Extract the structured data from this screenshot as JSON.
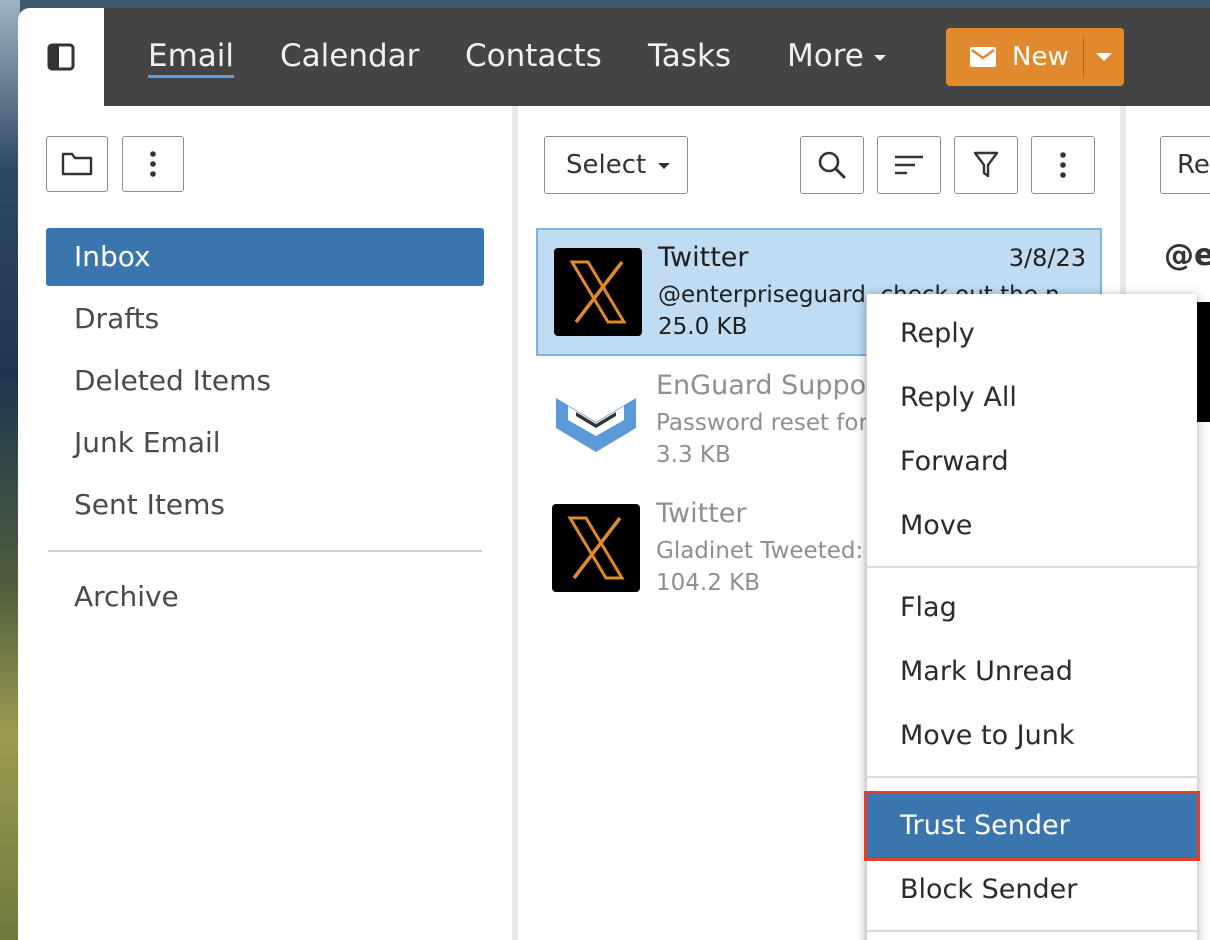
{
  "top_nav": {
    "tabs": [
      {
        "label": "Email"
      },
      {
        "label": "Calendar"
      },
      {
        "label": "Contacts"
      },
      {
        "label": "Tasks"
      },
      {
        "label": "More"
      }
    ],
    "new_button_label": "New"
  },
  "folders": {
    "items": [
      {
        "label": "Inbox"
      },
      {
        "label": "Drafts"
      },
      {
        "label": "Deleted Items"
      },
      {
        "label": "Junk Email"
      },
      {
        "label": "Sent Items"
      }
    ],
    "archive_label": "Archive"
  },
  "list_toolbar": {
    "select_label": "Select"
  },
  "messages": [
    {
      "sender": "Twitter",
      "date": "3/8/23",
      "preview": "@enterpriseguard, check out the n",
      "size": "25.0 KB"
    },
    {
      "sender": "EnGuard Support",
      "date": "",
      "preview": "Password reset for",
      "size": "3.3 KB"
    },
    {
      "sender": "Twitter",
      "date": "",
      "preview": "Gladinet Tweeted:",
      "size": "104.2 KB"
    }
  ],
  "reading_pane": {
    "reply_label": "Re",
    "subject_partial": "@e"
  },
  "context_menu": {
    "items": [
      {
        "label": "Reply"
      },
      {
        "label": "Reply All"
      },
      {
        "label": "Forward"
      },
      {
        "label": "Move"
      },
      {
        "label": "Flag"
      },
      {
        "label": "Mark Unread"
      },
      {
        "label": "Move to Junk"
      },
      {
        "label": "Trust Sender"
      },
      {
        "label": "Block Sender"
      }
    ]
  },
  "colors": {
    "topbar": "#444444",
    "accent_blue": "#3a76ad",
    "new_button": "#e08a2d",
    "selected_row": "#bfdcf3",
    "highlight_outline": "#e0402a"
  }
}
